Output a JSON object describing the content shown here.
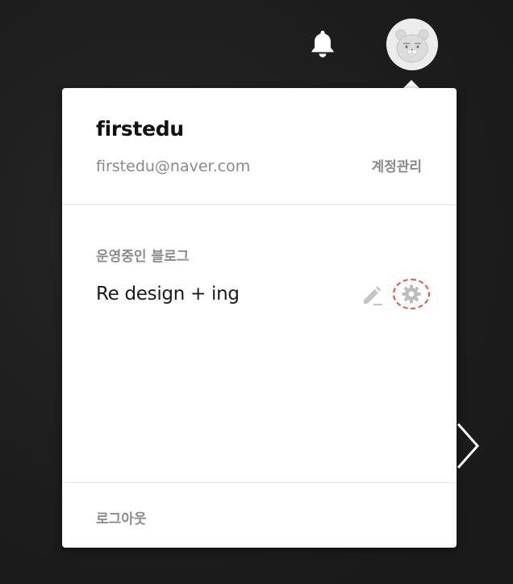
{
  "header": {
    "notification_icon": "bell-icon",
    "avatar_icon": "ryan-character-avatar"
  },
  "account_menu": {
    "username": "firstedu",
    "email": "firstedu@naver.com",
    "account_manage_label": "계정관리",
    "blogs_section_title": "운영중인 블로그",
    "blogs": [
      {
        "name": "Re design + ing",
        "edit_icon": "pencil-icon",
        "settings_icon": "gear-icon"
      }
    ],
    "logout_label": "로그아웃"
  },
  "colors": {
    "page_background": "#1e1e1e",
    "panel_background": "#ffffff",
    "muted_text": "#8a8a8a",
    "highlight_ring": "#e0593f"
  }
}
